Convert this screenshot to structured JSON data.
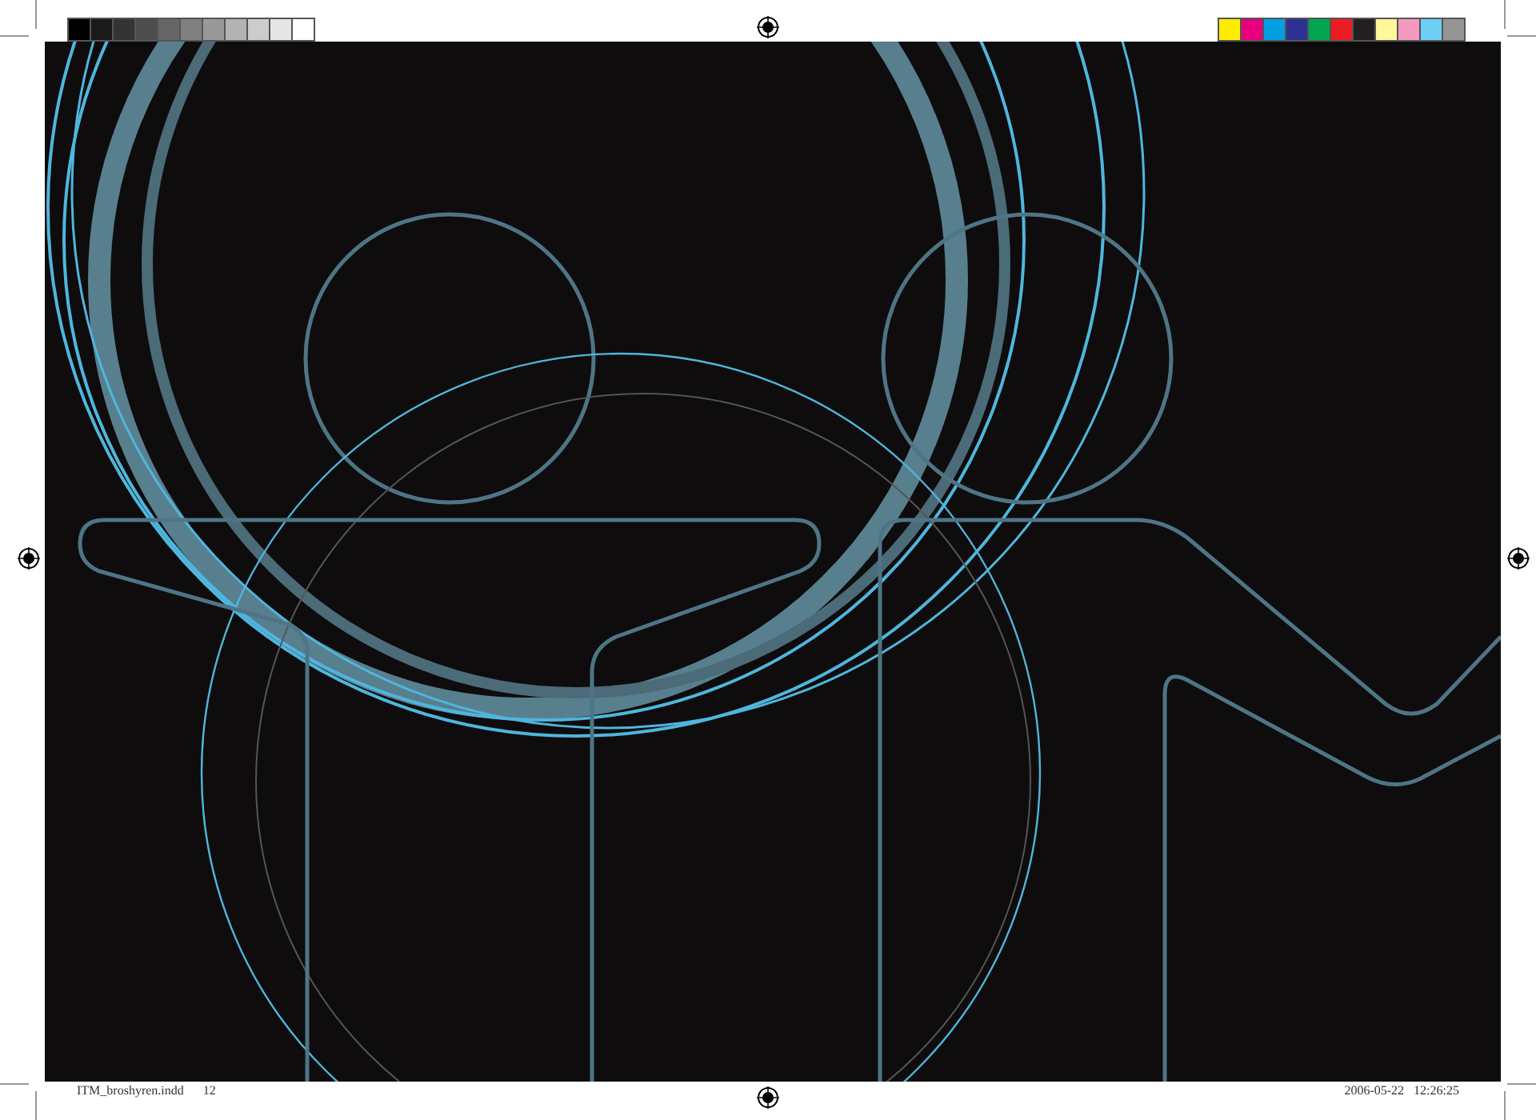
{
  "grayscale_bar": [
    {
      "color": "#000000"
    },
    {
      "color": "#1a1a1a"
    },
    {
      "color": "#333333"
    },
    {
      "color": "#4d4d4d"
    },
    {
      "color": "#666666"
    },
    {
      "color": "#808080"
    },
    {
      "color": "#999999"
    },
    {
      "color": "#b3b3b3"
    },
    {
      "color": "#cccccc"
    },
    {
      "color": "#e6e6e6"
    },
    {
      "color": "#ffffff"
    }
  ],
  "color_bar": [
    {
      "color": "#ffed00"
    },
    {
      "color": "#e6007e"
    },
    {
      "color": "#009fe3"
    },
    {
      "color": "#2e3192"
    },
    {
      "color": "#00a651"
    },
    {
      "color": "#ed1c24"
    },
    {
      "color": "#231f20"
    },
    {
      "color": "#fff799"
    },
    {
      "color": "#f49ac1"
    },
    {
      "color": "#6dcff6"
    },
    {
      "color": "#959595"
    }
  ],
  "slug": {
    "file_name": "ITM_broshyren.indd",
    "page": "12",
    "timestamp": "2006-05-22   12:26:25"
  }
}
